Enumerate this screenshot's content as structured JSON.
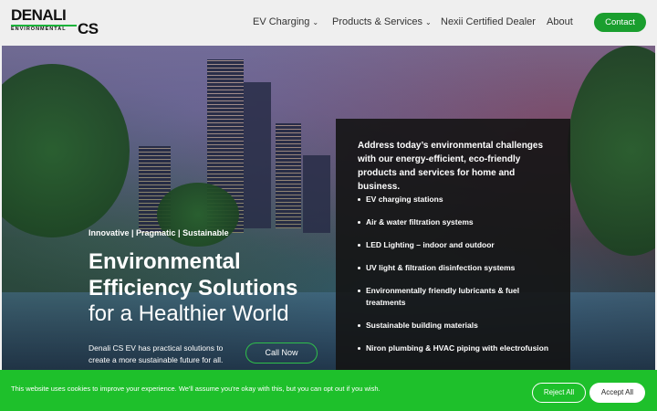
{
  "header": {
    "logo": {
      "word": "DENALI",
      "sub": "ENVIRONMENTAL",
      "cs": "CS"
    },
    "nav": [
      {
        "label": "EV Charging",
        "has_dropdown": true
      },
      {
        "label": "Products & Services",
        "has_dropdown": true
      },
      {
        "label": "Nexii Certified Dealer",
        "has_dropdown": false
      },
      {
        "label": "About",
        "has_dropdown": false
      }
    ],
    "contact_label": "Contact",
    "chevron": "⌄"
  },
  "hero": {
    "tagline": "Innovative | Pragmatic | Sustainable",
    "title_line1": "Environmental",
    "title_line2": "Efficiency Solutions",
    "title_line3": "for a Healthier World",
    "description": "Denali CS EV has practical solutions to create a more sustainable future for all.",
    "cta_label": "Call Now",
    "panel": {
      "heading": "Address today’s environmental challenges with our energy-efficient, eco-friendly products and services for home and business.",
      "items": [
        "EV charging stations",
        "Air & water filtration systems",
        "LED Lighting – indoor and outdoor",
        "UV light & filtration disinfection systems",
        "Environmentally friendly lubricants & fuel treatments",
        "Sustainable building materials",
        "Niron plumbing & HVAC piping with electrofusion"
      ]
    }
  },
  "cookie": {
    "text": "This website uses cookies to improve your experience. We'll assume you're okay with this, but you can opt out if you wish.",
    "reject_label": "Reject All",
    "accept_label": "Accept All"
  },
  "colors": {
    "brand_green": "#1a9e2e",
    "cookie_green": "#1ec02b",
    "panel_bg": "#141414"
  }
}
